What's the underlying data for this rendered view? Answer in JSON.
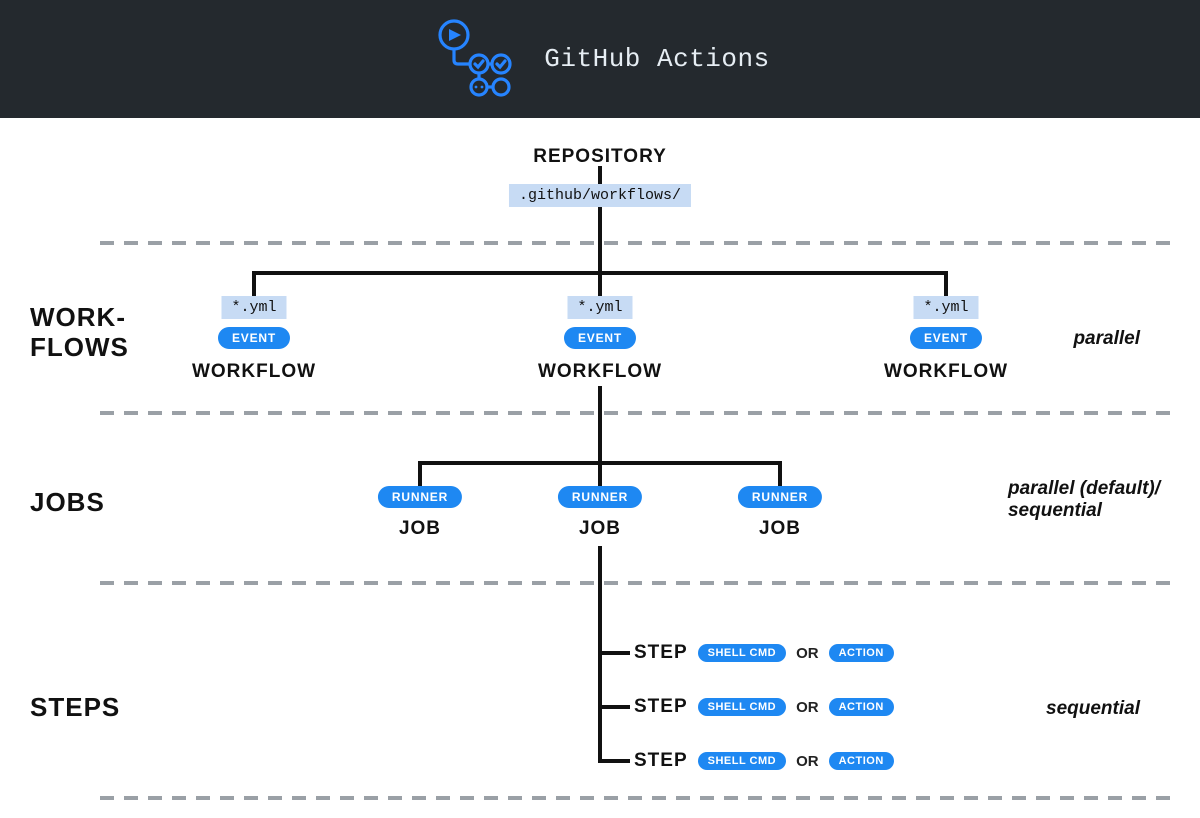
{
  "header": {
    "title": "GitHub Actions"
  },
  "repository": {
    "label": "REPOSITORY",
    "path": ".github/workflows/"
  },
  "sections": {
    "workflows": {
      "label": "WORK-\nFLOWS",
      "exec": "parallel"
    },
    "jobs": {
      "label": "JOBS",
      "exec": "parallel (default)/\nsequential"
    },
    "steps": {
      "label": "STEPS",
      "exec": "sequential"
    }
  },
  "workflows": [
    {
      "yml": "*.yml",
      "event": "EVENT",
      "title": "WORKFLOW"
    },
    {
      "yml": "*.yml",
      "event": "EVENT",
      "title": "WORKFLOW"
    },
    {
      "yml": "*.yml",
      "event": "EVENT",
      "title": "WORKFLOW"
    }
  ],
  "jobs": [
    {
      "runner": "RUNNER",
      "title": "JOB"
    },
    {
      "runner": "RUNNER",
      "title": "JOB"
    },
    {
      "runner": "RUNNER",
      "title": "JOB"
    }
  ],
  "steps": [
    {
      "title": "STEP",
      "shell": "SHELL CMD",
      "or": "OR",
      "action": "ACTION"
    },
    {
      "title": "STEP",
      "shell": "SHELL CMD",
      "or": "OR",
      "action": "ACTION"
    },
    {
      "title": "STEP",
      "shell": "SHELL CMD",
      "or": "OR",
      "action": "ACTION"
    }
  ]
}
